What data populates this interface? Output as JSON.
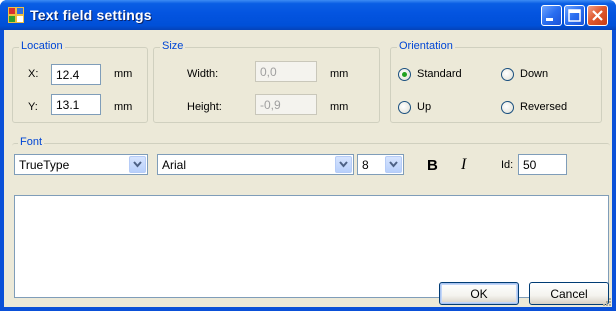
{
  "window": {
    "title": "Text field settings"
  },
  "icons": {
    "app": "app-icon",
    "minimize": "minimize-icon",
    "maximize": "maximize-icon",
    "close": "close-icon",
    "dropdown": "chevron-down-icon"
  },
  "location": {
    "label": "Location",
    "x_label": "X:",
    "x_value": "12.4",
    "x_unit": "mm",
    "y_label": "Y:",
    "y_value": "13.1",
    "y_unit": "mm"
  },
  "size": {
    "label": "Size",
    "width_label": "Width:",
    "width_value": "0,0",
    "width_unit": "mm",
    "height_label": "Height:",
    "height_value": "-0,9",
    "height_unit": "mm"
  },
  "orientation": {
    "label": "Orientation",
    "options": [
      "Standard",
      "Down",
      "Up",
      "Reversed"
    ],
    "selected": "Standard"
  },
  "font": {
    "label": "Font",
    "type_value": "TrueType",
    "face_value": "Arial",
    "size_value": "8",
    "bold_label": "B",
    "italic_label": "I",
    "id_label": "Id:",
    "id_value": "50"
  },
  "buttons": {
    "ok": "OK",
    "cancel": "Cancel"
  },
  "colors": {
    "titlebar": "#0054e3",
    "group_label": "#0046d5",
    "dialog_bg": "#ece9d8",
    "radio_dot": "#21a121"
  }
}
